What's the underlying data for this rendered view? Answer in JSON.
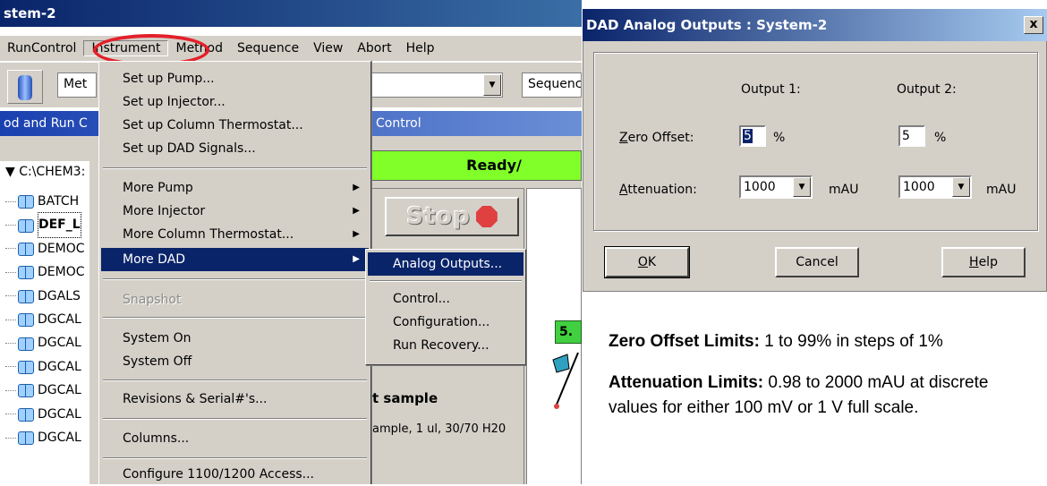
{
  "main_window": {
    "title": "stem-2",
    "menubar": [
      "RunControl",
      "Instrument",
      "Method",
      "Sequence",
      "View",
      "Abort",
      "Help"
    ],
    "toolbar": {
      "method_field": "Met",
      "sequence_field": "Sequenc"
    },
    "section_bar": {
      "left": "od and Run C",
      "right": "Control"
    },
    "status": "Ready/",
    "tree_root": "C:\\CHEM3:",
    "tree_items": [
      "BATCH",
      "DEF_L",
      "DEMOC",
      "DEMOC",
      "DGALS",
      "DGCAL",
      "DGCAL",
      "DGCAL",
      "DGCAL",
      "DGCAL",
      "DGCAL"
    ],
    "stop_label": "Stop",
    "vial_number": "5.",
    "sample": {
      "title": "t sample",
      "description": "ample, 1 ul, 30/70 H20"
    }
  },
  "instrument_menu": {
    "items": [
      "Set up Pump...",
      "Set up Injector...",
      "Set up Column Thermostat...",
      "Set up DAD  Signals...",
      "More Pump",
      "More Injector",
      "More Column Thermostat...",
      "More DAD",
      "Snapshot",
      "System On",
      "System Off",
      "Revisions & Serial#'s...",
      "Columns...",
      "Configure 1100/1200 Access..."
    ],
    "highlighted": "More DAD"
  },
  "dad_submenu": {
    "items": [
      "Analog Outputs...",
      "Control...",
      "Configuration...",
      "Run Recovery..."
    ],
    "highlighted": "Analog Outputs..."
  },
  "dialog": {
    "title": "DAD Analog Outputs : System-2",
    "close_glyph": "x",
    "output1_header": "Output 1:",
    "output2_header": "Output 2:",
    "zero_offset_label_first": "Z",
    "zero_offset_label_rest": "ero Offset:",
    "attenuation_label_first": "A",
    "attenuation_label_rest": "ttenuation:",
    "output1": {
      "zero_offset": "5",
      "zero_unit": "%",
      "attenuation": "1000",
      "att_unit": "mAU"
    },
    "output2": {
      "zero_offset": "5",
      "zero_unit": "%",
      "attenuation": "1000",
      "att_unit": "mAU"
    },
    "buttons": {
      "ok_first": "O",
      "ok_rest": "K",
      "cancel": "Cancel",
      "help_first": "H",
      "help_rest": "elp"
    }
  },
  "notes": {
    "zero_offset_heading": "Zero Offset Limits:",
    "zero_offset_text": " 1 to 99% in steps of 1%",
    "attenuation_heading": "Attenuation Limits:",
    "attenuation_text": " 0.98 to 2000 mAU at discrete values for either 100 mV or 1 V full scale."
  },
  "colors": {
    "highlight_ring": "#e3202a",
    "ready_green": "#80ff28",
    "menu_highlight": "#0a246a"
  }
}
